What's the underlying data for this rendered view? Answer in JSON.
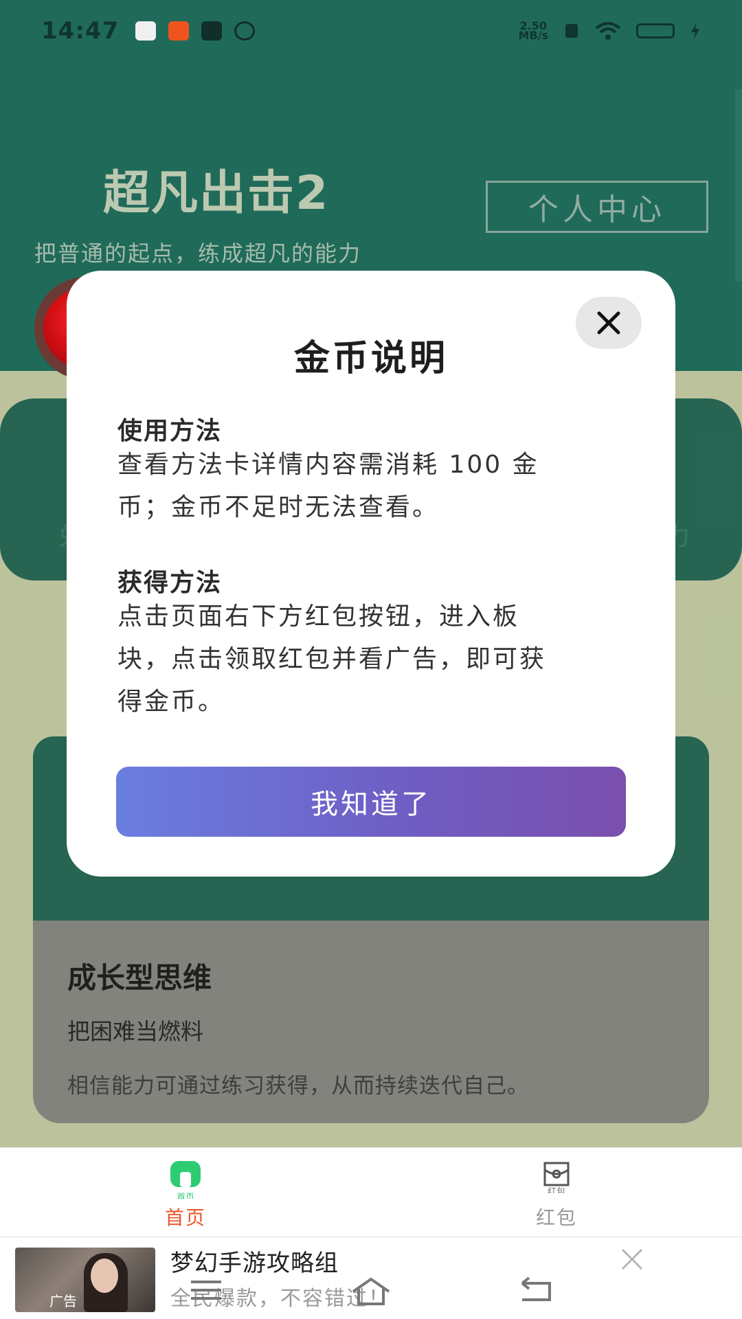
{
  "status": {
    "time": "14:47",
    "speed_top": "2.50",
    "speed_bottom": "MB/s"
  },
  "header": {
    "title": "超凡出击2",
    "subtitle": "把普通的起点，练成超凡的能力",
    "center_button": "个人中心"
  },
  "cards": {
    "card_a_left": "兑",
    "card_a_right": "力",
    "growth_title": "成长型思维",
    "growth_sub": "把困难当燃料",
    "growth_desc": "相信能力可通过练习获得，从而持续迭代自己。"
  },
  "red_packet": {
    "symbol": "¥"
  },
  "modal": {
    "title": "金币说明",
    "usage_title": "使用方法",
    "usage_line1": "查看方法卡详情内容需消耗 100 金",
    "usage_line2": "币；金币不足时无法查看。",
    "earn_title": "获得方法",
    "earn_line1": "点击页面右下方红包按钮，进入板",
    "earn_line2": "块，点击领取红包并看广告，即可获",
    "earn_line3": "得金币。",
    "confirm": "我知道了"
  },
  "tabs": {
    "home_label": "首页",
    "home_icon_caption": "首页",
    "red_label": "红包",
    "red_icon_caption": "红包",
    "active_color": "#e8582c",
    "inactive_color": "#9a9a9a",
    "home_icon_color": "#2ecc71"
  },
  "ad": {
    "badge": "广告",
    "title": "梦幻手游攻略组",
    "subtitle": "全民爆款，不容错过！"
  },
  "icons": {
    "modal_close": "close-icon",
    "ad_close": "close-icon",
    "home": "home-icon",
    "redpacket": "red-packet-icon"
  }
}
